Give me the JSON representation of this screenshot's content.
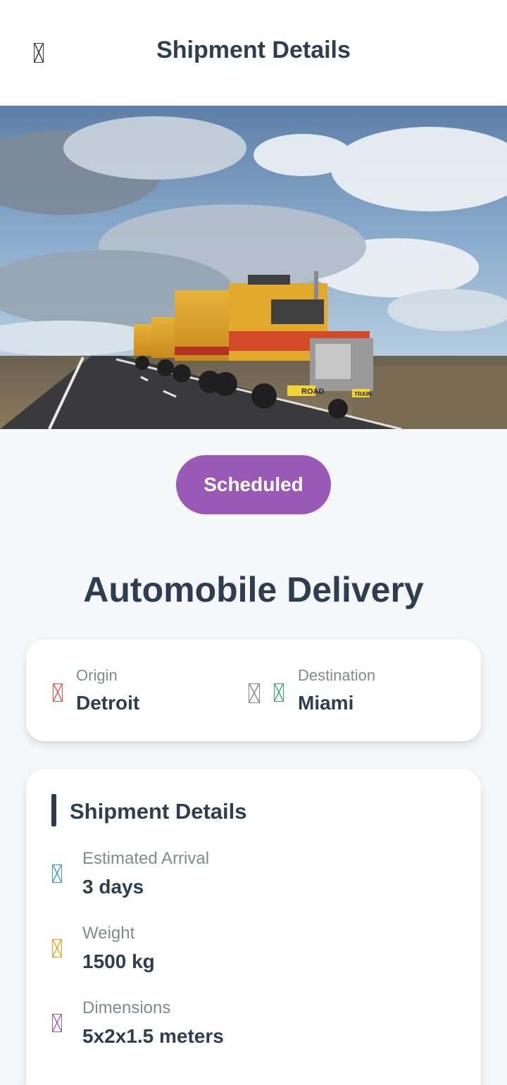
{
  "header": {
    "title": "Shipment Details",
    "back_icon": "arrow-left-icon"
  },
  "hero": {
    "alt": "truck-photo",
    "road_sign": "ROAD",
    "train_sign": "TRAIN"
  },
  "status": {
    "label": "Scheduled",
    "color": "#9b59b6"
  },
  "shipment": {
    "title": "Automobile Delivery"
  },
  "route": {
    "origin_label": "Origin",
    "origin_value": "Detroit",
    "origin_icon": "map-pin-icon",
    "origin_color": "#e74c3c",
    "arrow_icon": "arrow-right-icon",
    "arrow_color": "#7f8c8d",
    "destination_label": "Destination",
    "destination_value": "Miami",
    "destination_icon": "flag-icon",
    "destination_color": "#27ae60"
  },
  "details": {
    "title": "Shipment Details",
    "items": [
      {
        "label": "Estimated Arrival",
        "value": "3 days",
        "icon": "clock-icon",
        "color": "#3498db"
      },
      {
        "label": "Weight",
        "value": "1500 kg",
        "icon": "weight-icon",
        "color": "#f39c12"
      },
      {
        "label": "Dimensions",
        "value": "5x2x1.5 meters",
        "icon": "ruler-icon",
        "color": "#9b59b6"
      }
    ]
  }
}
